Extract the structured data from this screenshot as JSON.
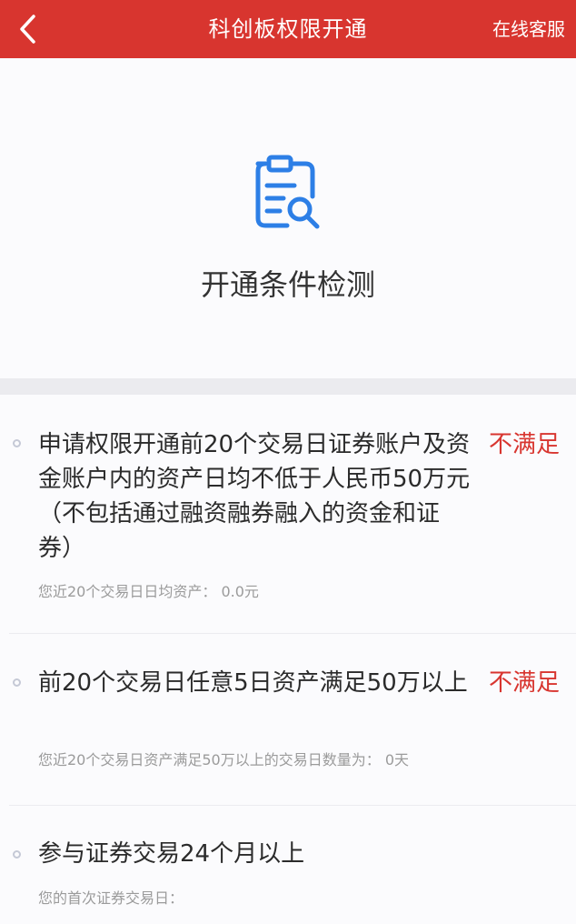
{
  "header": {
    "title": "科创板权限开通",
    "back_icon": "chevron-left-icon",
    "service_label": "在线客服",
    "bg_color": "#d8352f"
  },
  "hero": {
    "icon": "document-search-icon",
    "icon_color": "#2d7fe6",
    "title": "开通条件检测"
  },
  "conditions": [
    {
      "text": "申请权限开通前20个交易日证券账户及资金账户内的资产日均不低于人民币50万元 （不包括通过融资融券融入的资金和证券）",
      "status": "不满足",
      "detail_label": "您近20个交易日日均资产：",
      "detail_value": "0.0元"
    },
    {
      "text": "前20个交易日任意5日资产满足50万以上",
      "status": "不满足",
      "detail_label": "您近20个交易日资产满足50万以上的交易日数量为：",
      "detail_value": "0天"
    },
    {
      "text": "参与证券交易24个月以上",
      "status": "",
      "detail_label": "您的首次证券交易日：",
      "detail_value": ""
    }
  ],
  "status_color": "#d8352f"
}
